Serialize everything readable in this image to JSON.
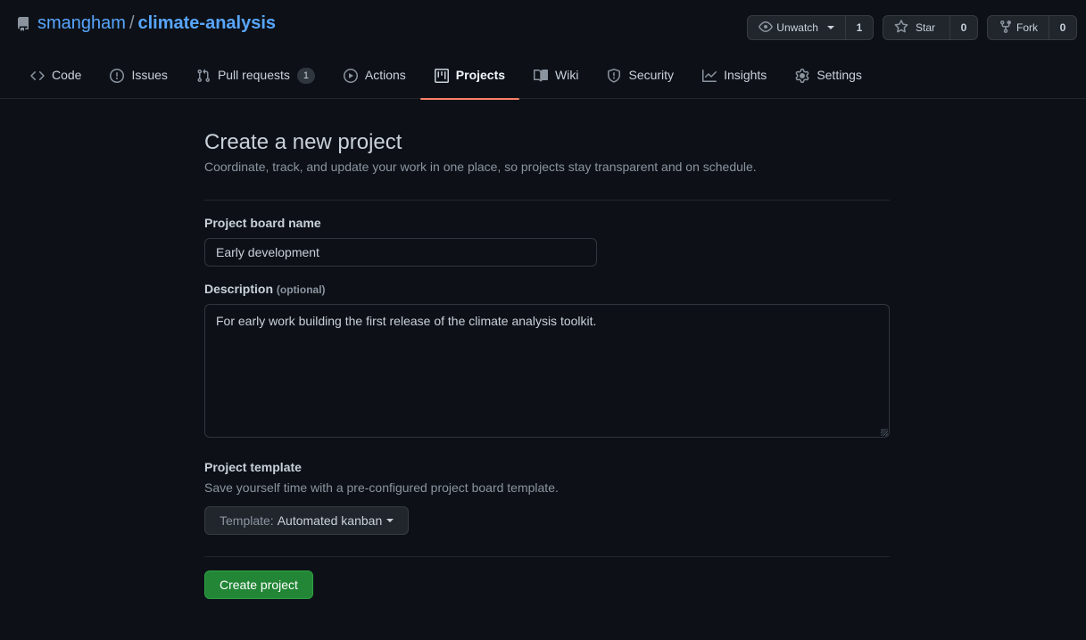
{
  "repo": {
    "owner": "smangham",
    "separator": "/",
    "name": "climate-analysis"
  },
  "actions": [
    {
      "label": "Unwatch",
      "icon": "eye-icon",
      "count": "1",
      "has_caret": true
    },
    {
      "label": "Star",
      "icon": "star-icon",
      "count": "0"
    },
    {
      "label": "Fork",
      "icon": "fork-icon",
      "count": "0"
    }
  ],
  "tabs": [
    {
      "label": "Code",
      "icon": "code-icon"
    },
    {
      "label": "Issues",
      "icon": "issue-icon"
    },
    {
      "label": "Pull requests",
      "icon": "pull-request-icon",
      "badge": "1"
    },
    {
      "label": "Actions",
      "icon": "play-icon"
    },
    {
      "label": "Projects",
      "icon": "project-icon",
      "active": true
    },
    {
      "label": "Wiki",
      "icon": "book-icon"
    },
    {
      "label": "Security",
      "icon": "shield-icon"
    },
    {
      "label": "Insights",
      "icon": "graph-icon"
    },
    {
      "label": "Settings",
      "icon": "gear-icon"
    }
  ],
  "form": {
    "title": "Create a new project",
    "subtitle": "Coordinate, track, and update your work in one place, so projects stay transparent and on schedule.",
    "name_label": "Project board name",
    "name_value": "Early development",
    "description_label": "Description",
    "description_optional": "(optional)",
    "description_value": "For early work building the first release of the climate analysis toolkit.",
    "template_label": "Project template",
    "template_hint": "Save yourself time with a pre-configured project board template.",
    "template_prefix": "Template:",
    "template_value": "Automated kanban",
    "submit_label": "Create project"
  },
  "colors": {
    "background": "#0d1117",
    "link": "#58a6ff",
    "active_tab_underline": "#f78166",
    "primary_button": "#238636"
  }
}
